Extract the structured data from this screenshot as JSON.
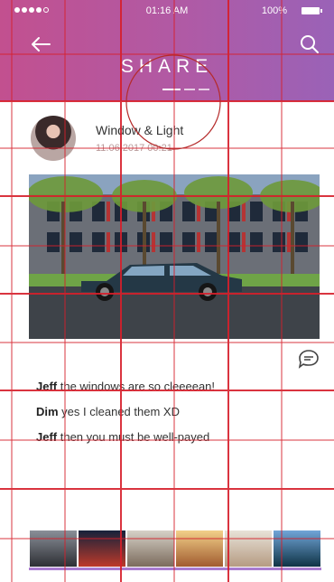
{
  "status_bar": {
    "time": "01:16 AM",
    "battery_text": "100%"
  },
  "header": {
    "title": "SHARE",
    "back_icon": "arrow-left-icon",
    "search_icon": "search-icon"
  },
  "post": {
    "author_avatar": "avatar",
    "title": "Window & Light",
    "date": "11.06.2017 00:21",
    "photo": "building-car-photo",
    "comment_icon": "comment-bubble-icon"
  },
  "comments": [
    {
      "author": "Jeff",
      "text": " the windows are so cleeeean!"
    },
    {
      "author": "Dim",
      "text": " yes I cleaned them XD"
    },
    {
      "author": "Jeff",
      "text": " then you must be well-payed"
    }
  ],
  "gallery": {
    "thumbs": [
      "thumb-1",
      "thumb-2",
      "thumb-3",
      "thumb-4",
      "thumb-5",
      "thumb-6"
    ]
  },
  "colors": {
    "header_start": "#c2508f",
    "header_end": "#9a62b7",
    "accent_line": "#a97bd0",
    "grid_red": "#d71f2b"
  }
}
